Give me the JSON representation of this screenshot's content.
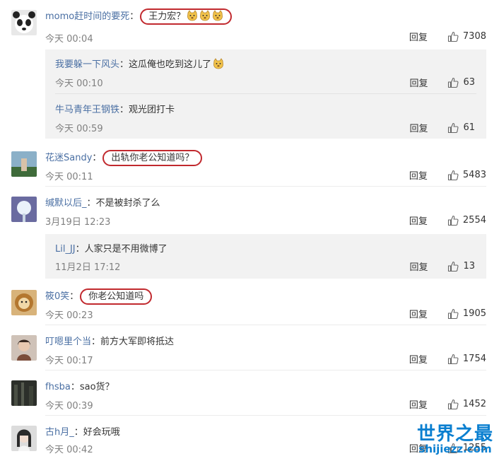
{
  "comments": [
    {
      "user": "momo赶时间的要死",
      "text": "王力宏？",
      "time": "今天 00:04",
      "reply": "回复",
      "likes": "7308"
    },
    {
      "user": "花迷Sandy",
      "text": "出轨你老公知道吗？",
      "time": "今天 00:11",
      "reply": "回复",
      "likes": "5483"
    },
    {
      "user": "缄默以后_",
      "text": "不是被封杀了么",
      "time": "3月19日 12:23",
      "reply": "回复",
      "likes": "2554"
    },
    {
      "user": "筱0笑",
      "text": "你老公知道吗",
      "time": "今天 00:23",
      "reply": "回复",
      "likes": "1905"
    },
    {
      "user": "叮嗯里个当",
      "text": "前方大军即将抵达",
      "time": "今天 00:17",
      "reply": "回复",
      "likes": "1754"
    },
    {
      "user": "fhsba",
      "text": "sao货？",
      "time": "今天 00:39",
      "reply": "回复",
      "likes": "1452"
    },
    {
      "user": "古h月_",
      "text": "好会玩哦",
      "time": "今天 00:42",
      "reply": "回复",
      "likes": "1255"
    }
  ],
  "replies": [
    {
      "user": "我要躲一下风头",
      "text": "这瓜俺也吃到这儿了",
      "time": "今天 00:10",
      "reply": "回复",
      "likes": "63"
    },
    {
      "user": "牛马青年王钢铁",
      "text": "观光团打卡",
      "time": "今天 00:59",
      "reply": "回复",
      "likes": "61"
    },
    {
      "user": "Lil_JJ",
      "text": "人家只是不用微博了",
      "time": "11月2日 17:12",
      "reply": "回复",
      "likes": "13"
    }
  ],
  "watermark": {
    "title": "世界之最",
    "url": "shijiezz.com"
  },
  "colors": {
    "username": "#4a6fa3",
    "highlight": "#c1292e",
    "reply_bg": "#f2f2f2"
  },
  "icons": [
    "thumbs-up-icon",
    "doge-emoji-icon"
  ]
}
